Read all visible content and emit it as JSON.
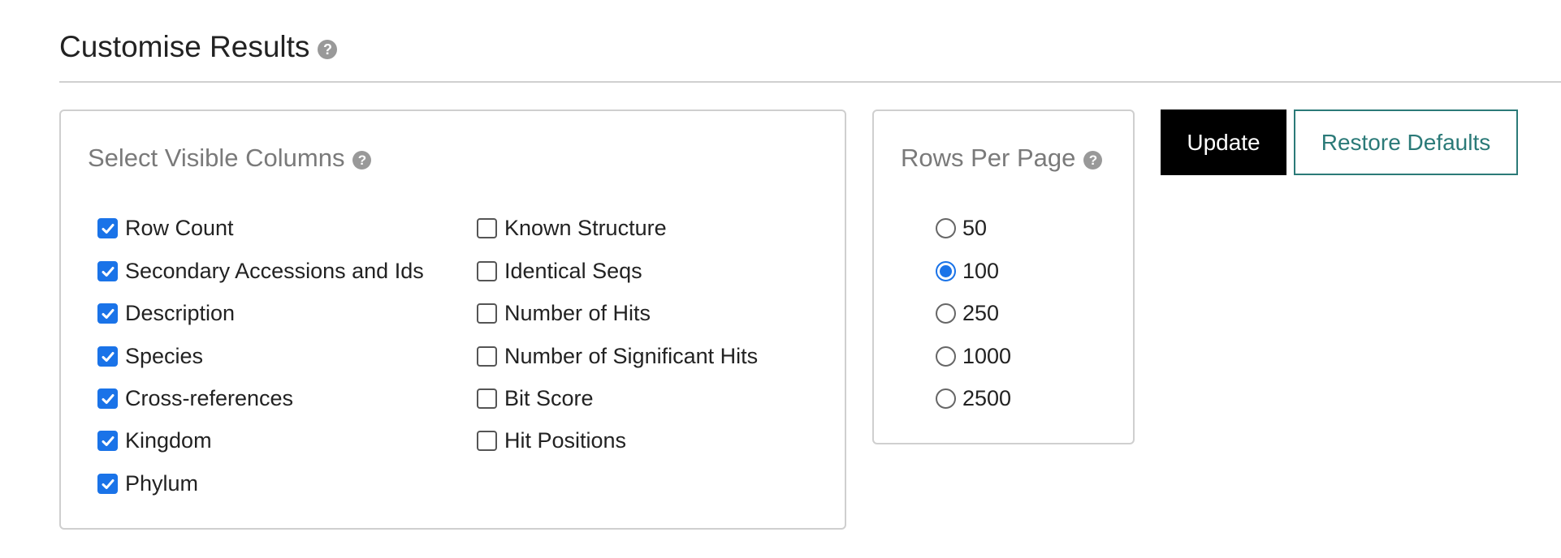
{
  "header": {
    "title": "Customise Results",
    "help_glyph": "?"
  },
  "columns": {
    "title": "Select Visible Columns",
    "help_glyph": "?",
    "left": [
      {
        "label": "Row Count",
        "checked": true
      },
      {
        "label": "Secondary Accessions and Ids",
        "checked": true
      },
      {
        "label": "Description",
        "checked": true
      },
      {
        "label": "Species",
        "checked": true
      },
      {
        "label": "Cross-references",
        "checked": true
      },
      {
        "label": "Kingdom",
        "checked": true
      },
      {
        "label": "Phylum",
        "checked": true
      }
    ],
    "right": [
      {
        "label": "Known Structure",
        "checked": false
      },
      {
        "label": "Identical Seqs",
        "checked": false
      },
      {
        "label": "Number of Hits",
        "checked": false
      },
      {
        "label": "Number of Significant Hits",
        "checked": false
      },
      {
        "label": "Bit Score",
        "checked": false
      },
      {
        "label": "Hit Positions",
        "checked": false
      }
    ]
  },
  "rows_per_page": {
    "title": "Rows Per Page",
    "help_glyph": "?",
    "options": [
      "50",
      "100",
      "250",
      "1000",
      "2500"
    ],
    "selected": "100"
  },
  "buttons": {
    "update_label": "Update",
    "restore_label": "Restore Defaults"
  },
  "colors": {
    "accent": "#1a73e8",
    "restore": "#2b7a78",
    "update_bg": "#000000"
  },
  "icons": {
    "help": "help-icon",
    "checkmark": "checkmark-icon"
  }
}
